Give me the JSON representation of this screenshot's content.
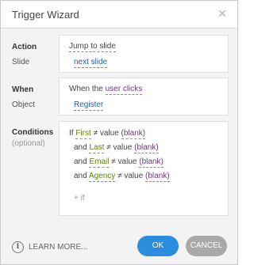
{
  "dialog": {
    "title": "Trigger Wizard",
    "close_glyph": "✕"
  },
  "action": {
    "label": "Action",
    "value": "Jump to slide",
    "slide_label": "Slide",
    "slide_value": "next slide"
  },
  "when": {
    "label": "When",
    "prefix": "When the",
    "value": "user clicks",
    "object_label": "Object",
    "object_value": "Register"
  },
  "conditions": {
    "label": "Conditions",
    "sublabel": "(optional)",
    "ne": "≠",
    "rows": [
      {
        "joiner": "If",
        "field": "First",
        "value": "value",
        "operand": "(blank)"
      },
      {
        "joiner": "and",
        "field": "Last",
        "value": "value",
        "operand": "(blank)"
      },
      {
        "joiner": "and",
        "field": "Email",
        "value": "value",
        "operand": "(blank)"
      },
      {
        "joiner": "and",
        "field": "Agency",
        "value": "value",
        "operand": "(blank)"
      }
    ],
    "add_if": "+ if"
  },
  "footer": {
    "info_glyph": "i",
    "learn_more": "LEARN MORE...",
    "ok": "OK",
    "cancel": "CANCEL"
  },
  "colors": {
    "accent": "#2a8de0",
    "cancel": "#a9a9a9",
    "field_green": "#5f7f10",
    "value_purple": "#6a3a7a"
  }
}
